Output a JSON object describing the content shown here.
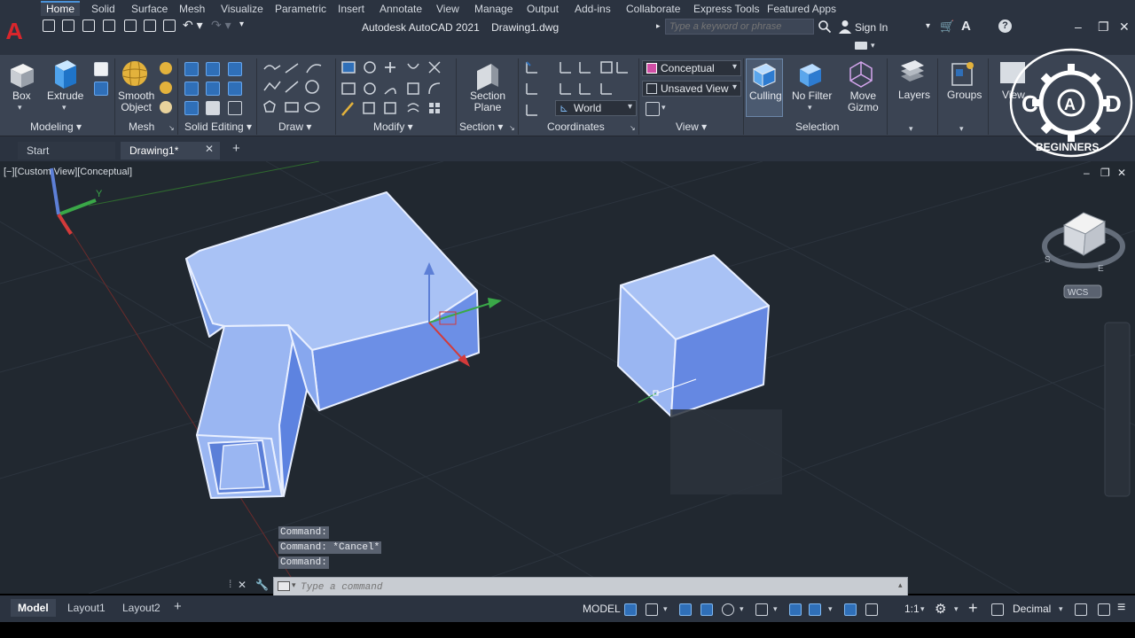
{
  "titlebar": {
    "app": "Autodesk AutoCAD 2021",
    "file": "Drawing1.dwg",
    "search_placeholder": "Type a keyword or phrase",
    "signin": "Sign In"
  },
  "menu_tabs": [
    "Home",
    "Solid",
    "Surface",
    "Mesh",
    "Visualize",
    "Parametric",
    "Insert",
    "Annotate",
    "View",
    "Manage",
    "Output",
    "Add-ins",
    "Collaborate",
    "Express Tools",
    "Featured Apps"
  ],
  "active_tab": "Home",
  "ribbon": {
    "box": "Box",
    "extrude": "Extrude",
    "smooth_object_1": "Smooth",
    "smooth_object_2": "Object",
    "section_plane_1": "Section",
    "section_plane_2": "Plane",
    "visual_style": "Conceptual",
    "view_name": "Unsaved View",
    "ucs": "World",
    "culling": "Culling",
    "no_filter": "No Filter",
    "move_gizmo_1": "Move",
    "move_gizmo_2": "Gizmo",
    "layers": "Layers",
    "groups": "Groups",
    "view_btn": "View",
    "panels": {
      "modeling": "Modeling",
      "mesh": "Mesh",
      "solid_editing": "Solid Editing",
      "draw": "Draw",
      "modify": "Modify",
      "section": "Section",
      "coordinates": "Coordinates",
      "view": "View",
      "selection": "Selection"
    }
  },
  "file_tabs": {
    "start": "Start",
    "drawing": "Drawing1*"
  },
  "viewport": {
    "label": "[−][Custom View][Conceptual]",
    "wcs": "WCS",
    "ucs_y": "Y"
  },
  "commands": [
    "Command:",
    "Command: *Cancel*",
    "Command:"
  ],
  "command_placeholder": "Type a command",
  "layouts": [
    "Model",
    "Layout1",
    "Layout2"
  ],
  "status": {
    "model": "MODEL",
    "scale": "1:1",
    "units": "Decimal"
  },
  "logo": {
    "letters": [
      "C",
      "A",
      "D"
    ],
    "caption": "BEGINNERS"
  },
  "colors": {
    "accent": "#4a92d8",
    "solid_fill": "#8fb0f0",
    "brand": "#d9262c"
  }
}
